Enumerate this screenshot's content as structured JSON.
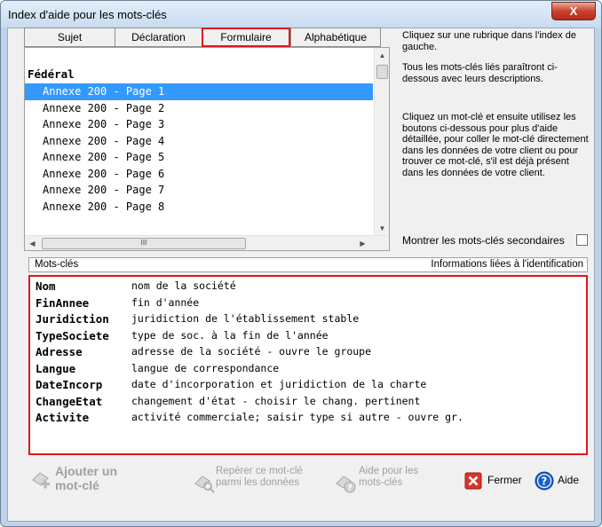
{
  "window": {
    "title": "Index d'aide pour les mots-clés",
    "close_symbol": "X"
  },
  "tabs": [
    {
      "label": "Sujet"
    },
    {
      "label": "Déclaration"
    },
    {
      "label": "Formulaire"
    },
    {
      "label": "Alphabétique"
    }
  ],
  "form_list": {
    "heading": "Fédéral",
    "selected_index": 0,
    "items": [
      "Annexe 200 - Page 1",
      "Annexe 200 - Page 2",
      "Annexe 200 - Page 3",
      "Annexe 200 - Page 4",
      "Annexe 200 - Page 5",
      "Annexe 200 - Page 6",
      "Annexe 200 - Page 7",
      "Annexe 200 - Page 8"
    ],
    "hscroll_thumb_grip": "III"
  },
  "help": {
    "p1": "Cliquez sur une rubrique dans l'index de gauche.",
    "p2": "Tous les mots-clés liés paraîtront ci-dessous avec leurs descriptions.",
    "p3": "Cliquez un mot-clé et ensuite utilisez les boutons ci-dessous pour plus d'aide détaillée, pour coller le mot-clé directement dans les données de votre client ou pour trouver ce mot-clé, s'il est déjà présent dans les données de votre client."
  },
  "secondary_keywords_label": "Montrer les mots-clés secondaires",
  "keywords_table": {
    "header_left": "Mots-clés",
    "header_right": "Informations liées à l'identification",
    "rows": [
      {
        "name": "Nom",
        "desc": "nom de la société"
      },
      {
        "name": "FinAnnee",
        "desc": "fin d'année"
      },
      {
        "name": "Juridiction",
        "desc": "juridiction de l'établissement stable"
      },
      {
        "name": "TypeSociete",
        "desc": "type de soc. à la fin de l'année"
      },
      {
        "name": "Adresse",
        "desc": "adresse de la société - ouvre le groupe"
      },
      {
        "name": "Langue",
        "desc": "langue de correspondance"
      },
      {
        "name": "DateIncorp",
        "desc": "date d'incorporation et juridiction de la charte"
      },
      {
        "name": "ChangeEtat",
        "desc": "changement d'état - choisir le chang. pertinent"
      },
      {
        "name": "Activite",
        "desc": "activité commerciale; saisir type si autre - ouvre gr."
      }
    ]
  },
  "buttons": {
    "add_keyword_line1": "Ajouter un",
    "add_keyword_line2": "mot-clé",
    "find_keyword_line1": "Repérer ce mot-clé",
    "find_keyword_line2": "parmi les données",
    "help_keyword_line1": "Aide pour les",
    "help_keyword_line2": "mots-clés",
    "close": "Fermer",
    "help": "Aide"
  },
  "colors": {
    "selection": "#3399ff",
    "highlight_red": "#e0161e",
    "close_button_red": "#c9412c",
    "help_blue": "#1a5fc9"
  }
}
